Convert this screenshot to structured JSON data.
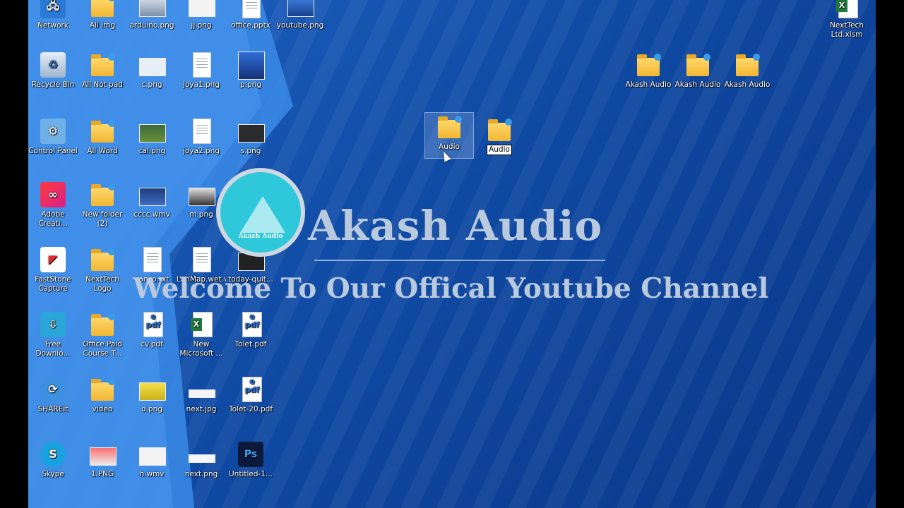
{
  "window": {
    "title": "Desktop"
  },
  "icons": {
    "col1": [
      "Network",
      "Recycle Bin",
      "Control Panel",
      "Adobe Creati...",
      "FastStone Capture",
      "Free Downlo...",
      "SHAREit",
      "Skype"
    ],
    "col2": [
      "All img",
      "All Not pad",
      "All Word",
      "New folder (2)",
      "NextTech Logo",
      "Office Paid Course T...",
      "video",
      "1.PNG"
    ],
    "col3": [
      "arduino.png",
      "c.png",
      "cal.png",
      "cccc.wmv",
      "conco.txt",
      "cv.pdf",
      "d.png",
      "h.wmv"
    ],
    "col4": [
      "jj.png",
      "joya1.png",
      "joya2.png",
      "m.png",
      "LanMap.wet.vcf",
      "New Microsoft ...",
      "next.jpg",
      "next.png"
    ],
    "col5": [
      "office.pptx",
      "p.png",
      "s.png",
      "today-quit...",
      "Tolet.pdf",
      "Tolet-20.pdf",
      "Untitled-1..."
    ],
    "extra": {
      "youtube": "youtube.png",
      "nexttech_xlsm": "NextTech Ltd.xlsm",
      "logo_xlsx": "Akash Aud..."
    }
  },
  "folders_right": [
    "Akash Audio",
    "Akash Audio",
    "Akash Audio"
  ],
  "folders_mid": {
    "selected": "Audio",
    "renaming": "Audio"
  },
  "brand": {
    "title": "Akash Audio",
    "subtitle": "Welcome To Our Offical Youtube Channel",
    "logo_text": "Akash Audio"
  },
  "colors": {
    "desktop_bg": "#1253b5",
    "shard": "#3a8be6",
    "logo_ring": "#2fc7da"
  }
}
